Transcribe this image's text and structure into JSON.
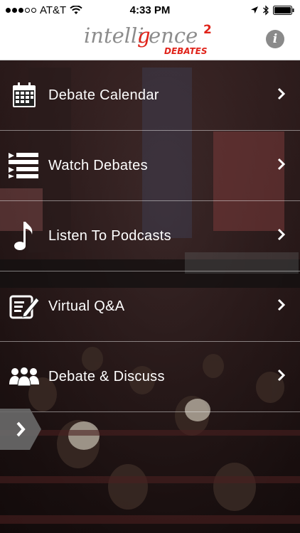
{
  "status_bar": {
    "carrier": "AT&T",
    "time": "4:33 PM"
  },
  "header": {
    "logo_text": "intelligence",
    "logo_superscript": "2",
    "logo_subtitle": "DEBATES",
    "info_icon_text": "i"
  },
  "menu": [
    {
      "label": "Debate Calendar",
      "icon": "calendar-icon"
    },
    {
      "label": "Watch Debates",
      "icon": "video-list-icon"
    },
    {
      "label": "Listen To Podcasts",
      "icon": "music-note-icon"
    },
    {
      "label": "Virtual Q&A",
      "icon": "edit-note-icon"
    },
    {
      "label": "Debate & Discuss",
      "icon": "group-icon"
    }
  ],
  "colors": {
    "accent_red": "#e0231a",
    "logo_gray": "#8c8c8c",
    "menu_text": "#ffffff"
  }
}
